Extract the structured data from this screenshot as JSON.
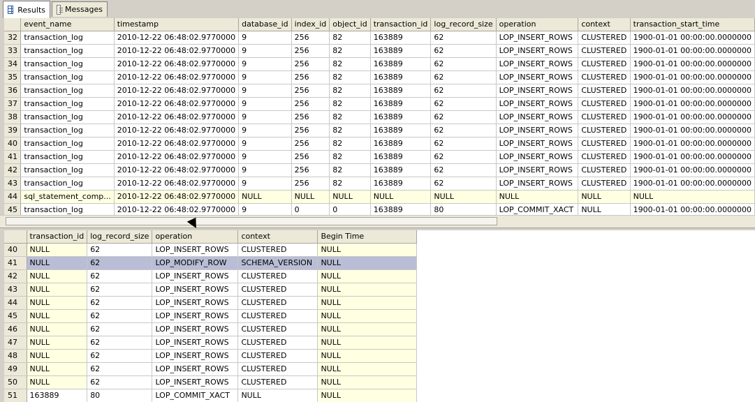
{
  "tabs": [
    {
      "label": "Results",
      "icon": "grid-icon",
      "active": true
    },
    {
      "label": "Messages",
      "icon": "messages-icon",
      "active": false
    }
  ],
  "top_grid": {
    "columns": [
      "event_name",
      "timestamp",
      "database_id",
      "index_id",
      "object_id",
      "transaction_id",
      "log_record_size",
      "operation",
      "context",
      "transaction_start_time"
    ],
    "rows": [
      [
        "32",
        "transaction_log",
        "2010-12-22 06:48:02.9770000",
        "9",
        "256",
        "82",
        "163889",
        "62",
        "LOP_INSERT_ROWS",
        "CLUSTERED",
        "1900-01-01 00:00:00.0000000"
      ],
      [
        "33",
        "transaction_log",
        "2010-12-22 06:48:02.9770000",
        "9",
        "256",
        "82",
        "163889",
        "62",
        "LOP_INSERT_ROWS",
        "CLUSTERED",
        "1900-01-01 00:00:00.0000000"
      ],
      [
        "34",
        "transaction_log",
        "2010-12-22 06:48:02.9770000",
        "9",
        "256",
        "82",
        "163889",
        "62",
        "LOP_INSERT_ROWS",
        "CLUSTERED",
        "1900-01-01 00:00:00.0000000"
      ],
      [
        "35",
        "transaction_log",
        "2010-12-22 06:48:02.9770000",
        "9",
        "256",
        "82",
        "163889",
        "62",
        "LOP_INSERT_ROWS",
        "CLUSTERED",
        "1900-01-01 00:00:00.0000000"
      ],
      [
        "36",
        "transaction_log",
        "2010-12-22 06:48:02.9770000",
        "9",
        "256",
        "82",
        "163889",
        "62",
        "LOP_INSERT_ROWS",
        "CLUSTERED",
        "1900-01-01 00:00:00.0000000"
      ],
      [
        "37",
        "transaction_log",
        "2010-12-22 06:48:02.9770000",
        "9",
        "256",
        "82",
        "163889",
        "62",
        "LOP_INSERT_ROWS",
        "CLUSTERED",
        "1900-01-01 00:00:00.0000000"
      ],
      [
        "38",
        "transaction_log",
        "2010-12-22 06:48:02.9770000",
        "9",
        "256",
        "82",
        "163889",
        "62",
        "LOP_INSERT_ROWS",
        "CLUSTERED",
        "1900-01-01 00:00:00.0000000"
      ],
      [
        "39",
        "transaction_log",
        "2010-12-22 06:48:02.9770000",
        "9",
        "256",
        "82",
        "163889",
        "62",
        "LOP_INSERT_ROWS",
        "CLUSTERED",
        "1900-01-01 00:00:00.0000000"
      ],
      [
        "40",
        "transaction_log",
        "2010-12-22 06:48:02.9770000",
        "9",
        "256",
        "82",
        "163889",
        "62",
        "LOP_INSERT_ROWS",
        "CLUSTERED",
        "1900-01-01 00:00:00.0000000"
      ],
      [
        "41",
        "transaction_log",
        "2010-12-22 06:48:02.9770000",
        "9",
        "256",
        "82",
        "163889",
        "62",
        "LOP_INSERT_ROWS",
        "CLUSTERED",
        "1900-01-01 00:00:00.0000000"
      ],
      [
        "42",
        "transaction_log",
        "2010-12-22 06:48:02.9770000",
        "9",
        "256",
        "82",
        "163889",
        "62",
        "LOP_INSERT_ROWS",
        "CLUSTERED",
        "1900-01-01 00:00:00.0000000"
      ],
      [
        "43",
        "transaction_log",
        "2010-12-22 06:48:02.9770000",
        "9",
        "256",
        "82",
        "163889",
        "62",
        "LOP_INSERT_ROWS",
        "CLUSTERED",
        "1900-01-01 00:00:00.0000000"
      ],
      [
        "44",
        "sql_statement_comp...",
        "2010-12-22 06:48:02.9770000",
        "NULL",
        "NULL",
        "NULL",
        "NULL",
        "NULL",
        "NULL",
        "NULL",
        "NULL"
      ],
      [
        "45",
        "transaction_log",
        "2010-12-22 06:48:02.9770000",
        "9",
        "0",
        "0",
        "163889",
        "80",
        "LOP_COMMIT_XACT",
        "NULL",
        "1900-01-01 00:00:00.0000000"
      ]
    ]
  },
  "bottom_grid": {
    "columns": [
      "transaction_id",
      "log_record_size",
      "operation",
      "context",
      "Begin Time"
    ],
    "selected_row": "41",
    "rows": [
      [
        "40",
        "NULL",
        "62",
        "LOP_INSERT_ROWS",
        "CLUSTERED",
        "NULL"
      ],
      [
        "41",
        "NULL",
        "62",
        "LOP_MODIFY_ROW",
        "SCHEMA_VERSION",
        "NULL"
      ],
      [
        "42",
        "NULL",
        "62",
        "LOP_INSERT_ROWS",
        "CLUSTERED",
        "NULL"
      ],
      [
        "43",
        "NULL",
        "62",
        "LOP_INSERT_ROWS",
        "CLUSTERED",
        "NULL"
      ],
      [
        "44",
        "NULL",
        "62",
        "LOP_INSERT_ROWS",
        "CLUSTERED",
        "NULL"
      ],
      [
        "45",
        "NULL",
        "62",
        "LOP_INSERT_ROWS",
        "CLUSTERED",
        "NULL"
      ],
      [
        "46",
        "NULL",
        "62",
        "LOP_INSERT_ROWS",
        "CLUSTERED",
        "NULL"
      ],
      [
        "47",
        "NULL",
        "62",
        "LOP_INSERT_ROWS",
        "CLUSTERED",
        "NULL"
      ],
      [
        "48",
        "NULL",
        "62",
        "LOP_INSERT_ROWS",
        "CLUSTERED",
        "NULL"
      ],
      [
        "49",
        "NULL",
        "62",
        "LOP_INSERT_ROWS",
        "CLUSTERED",
        "NULL"
      ],
      [
        "50",
        "NULL",
        "62",
        "LOP_INSERT_ROWS",
        "CLUSTERED",
        "NULL"
      ],
      [
        "51",
        "163889",
        "80",
        "LOP_COMMIT_XACT",
        "NULL",
        "NULL"
      ]
    ]
  },
  "colors": {
    "grid_header": "#ece9d8",
    "null_cell": "#ffffe1",
    "selected_row": "#b9bdd5"
  }
}
